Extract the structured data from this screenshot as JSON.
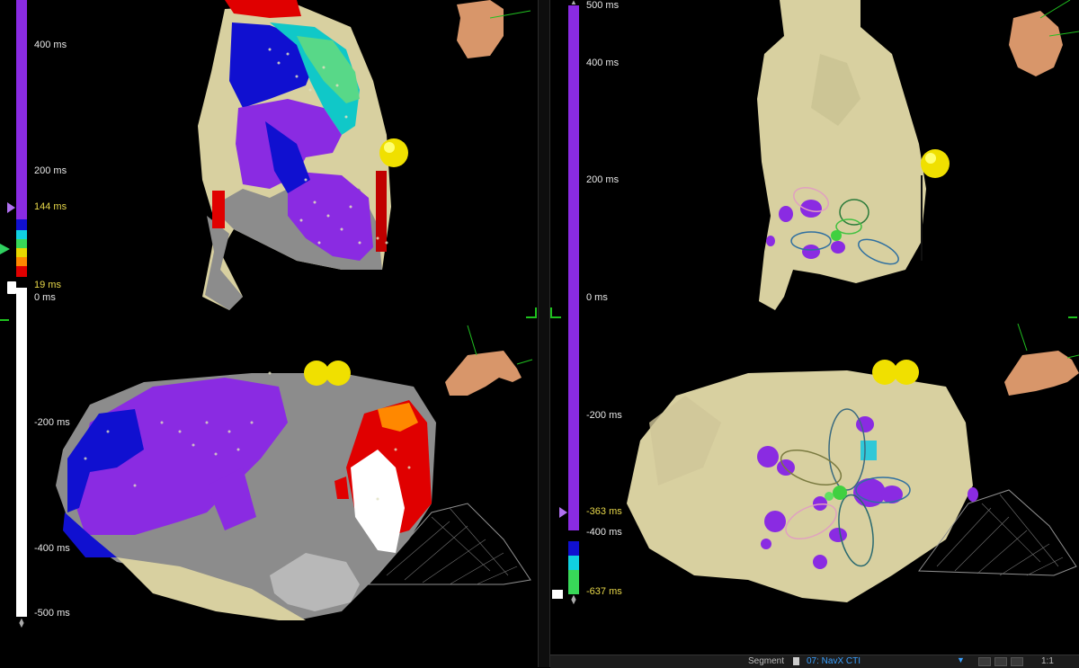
{
  "left_panel": {
    "ticks": [
      {
        "label": "400 ms"
      },
      {
        "label": "200 ms"
      },
      {
        "label": "144 ms",
        "highlight": true
      },
      {
        "label": "19 ms",
        "highlight": true
      },
      {
        "label": "0 ms"
      },
      {
        "label": "-200 ms"
      },
      {
        "label": "-400 ms"
      },
      {
        "label": "-500 ms"
      }
    ]
  },
  "right_panel": {
    "ticks": [
      {
        "label": "500 ms"
      },
      {
        "label": "400 ms"
      },
      {
        "label": "200 ms"
      },
      {
        "label": "0 ms"
      },
      {
        "label": "-200 ms"
      },
      {
        "label": "-363 ms",
        "highlight": true
      },
      {
        "label": "-400 ms"
      },
      {
        "label": "-637 ms",
        "highlight": true
      }
    ]
  },
  "colors": {
    "late_purple": "#8a2be2",
    "blue": "#1010d0",
    "cyan": "#10d0e0",
    "green": "#38d858",
    "yellow": "#e8d800",
    "orange": "#ff8800",
    "red": "#e00000",
    "tissue_beige": "#d8d0a0",
    "scar_gray": "#8c8c8c",
    "highlight_text": "#e8d84a",
    "grid_corner": "#1ec21e"
  },
  "status_bar": {
    "segment_label": "Segment",
    "segment_value": "07: NavX CTI",
    "zoom": "1:1"
  },
  "icons": [
    "play-icon",
    "step-back-icon",
    "step-forward-icon",
    "window-marker-icon",
    "threshold-marker-icon"
  ]
}
